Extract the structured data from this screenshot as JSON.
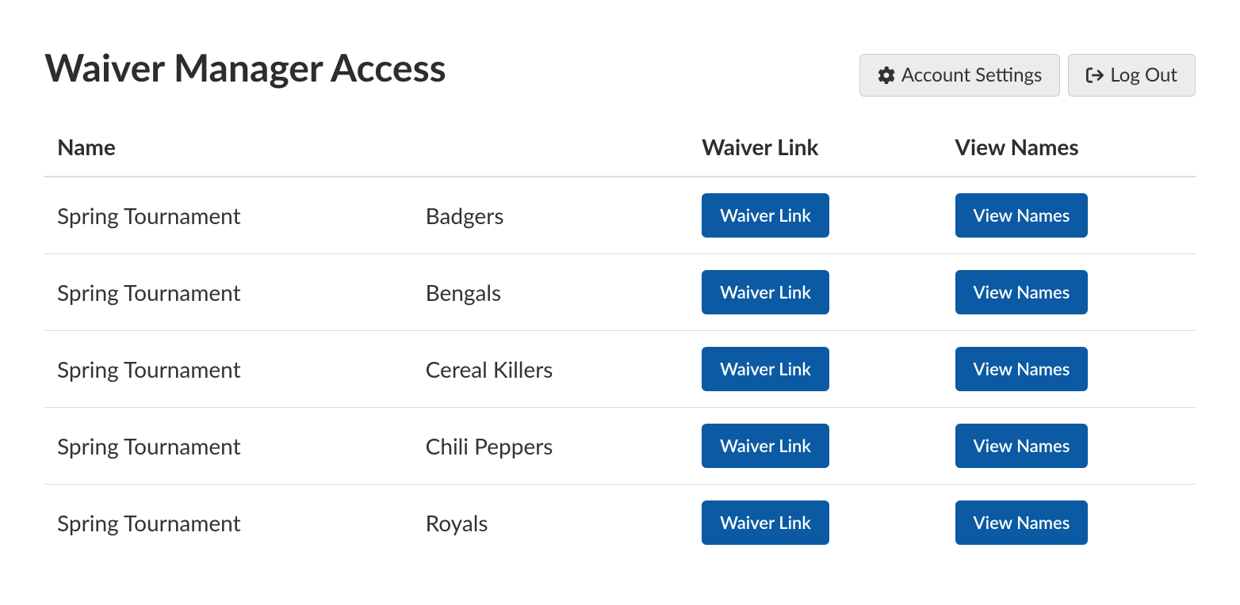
{
  "header": {
    "title": "Waiver Manager Access",
    "account_settings_label": "Account Settings",
    "logout_label": "Log Out"
  },
  "table": {
    "columns": {
      "name": "Name",
      "waiver_link": "Waiver Link",
      "view_names": "View Names"
    },
    "waiver_button_label": "Waiver Link",
    "view_button_label": "View Names",
    "rows": [
      {
        "event": "Spring Tournament",
        "team": "Badgers"
      },
      {
        "event": "Spring Tournament",
        "team": "Bengals"
      },
      {
        "event": "Spring Tournament",
        "team": "Cereal Killers"
      },
      {
        "event": "Spring Tournament",
        "team": "Chili Peppers"
      },
      {
        "event": "Spring Tournament",
        "team": "Royals"
      }
    ]
  }
}
